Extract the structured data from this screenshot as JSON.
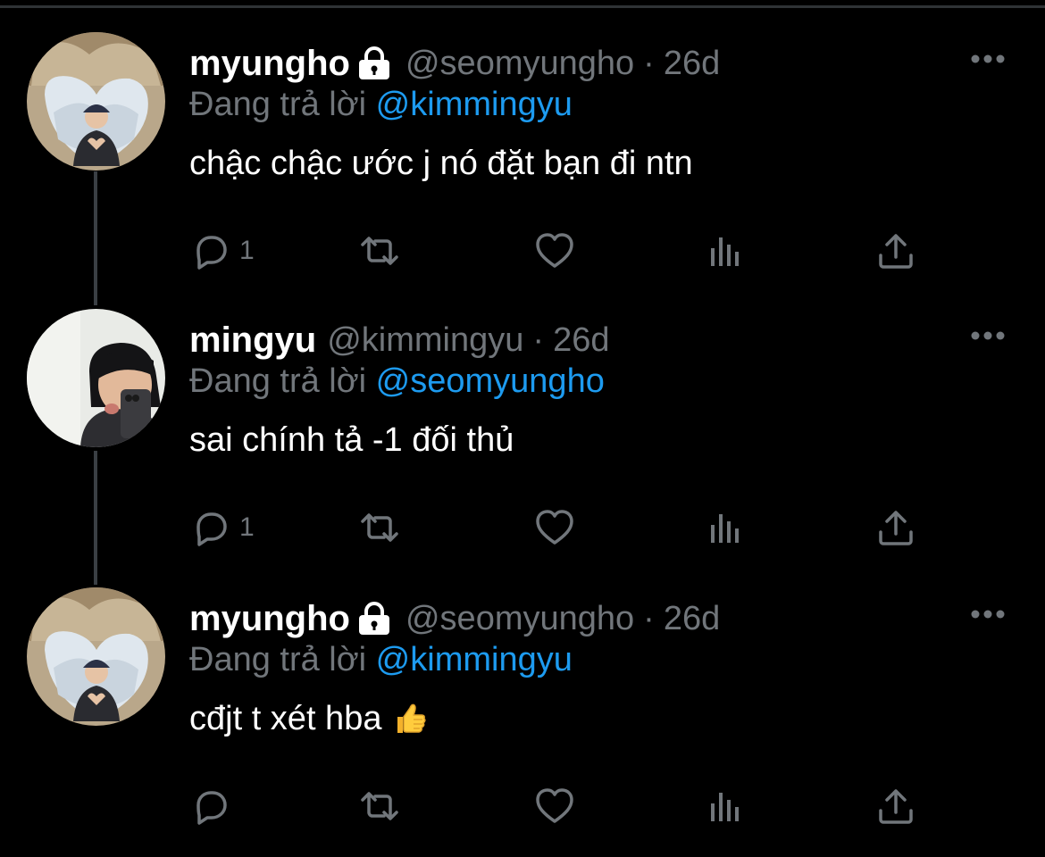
{
  "tweets": [
    {
      "name": "myungho",
      "locked": true,
      "handle": "@seomyungho",
      "dot": "·",
      "time": "26d",
      "replying_prefix": "Đang trả lời",
      "replying_to": "@kimmingyu",
      "text": "chậc chậc ước j nó đặt bạn đi ntn",
      "reply_count": "1",
      "emoji": ""
    },
    {
      "name": "mingyu",
      "locked": false,
      "handle": "@kimmingyu",
      "dot": "·",
      "time": "26d",
      "replying_prefix": "Đang trả lời",
      "replying_to": "@seomyungho",
      "text": "sai chính tả -1 đối thủ",
      "reply_count": "1",
      "emoji": ""
    },
    {
      "name": "myungho",
      "locked": true,
      "handle": "@seomyungho",
      "dot": "·",
      "time": "26d",
      "replying_prefix": "Đang trả lời",
      "replying_to": "@kimmingyu",
      "text": "cđjt t xét hba",
      "reply_count": "",
      "emoji": "thumbs-up"
    }
  ],
  "icons": {
    "lock": "lock-icon",
    "more": "more-icon",
    "reply": "reply-icon",
    "retweet": "retweet-icon",
    "like": "heart-icon",
    "views": "analytics-icon",
    "share": "share-icon"
  },
  "colors": {
    "background": "#000000",
    "primary_text": "#ffffff",
    "secondary_text": "#71767b",
    "mention": "#1d9bf0",
    "thread_line": "#3a3f44"
  }
}
